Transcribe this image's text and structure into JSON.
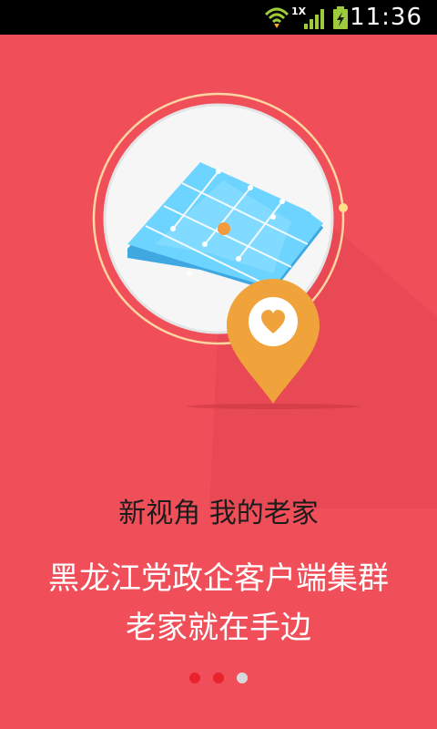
{
  "status_bar": {
    "time": "11:36",
    "network_label": "1X",
    "icons": [
      "wifi-icon",
      "signal-icon",
      "battery-charging-icon"
    ]
  },
  "onboarding": {
    "subtitle": "新视角 我的老家",
    "headline_line1": "黑龙江党政企客户端集群",
    "headline_line2": "老家就在手边",
    "page_indicator": {
      "total": 3,
      "current": 2,
      "active_color": "#e8232e",
      "inactive_color": "#d9d9d9"
    }
  },
  "colors": {
    "background": "#f04f59",
    "pin": "#f0a33a",
    "map_tile": "#52c3f2",
    "ring": "#ffd98a"
  }
}
